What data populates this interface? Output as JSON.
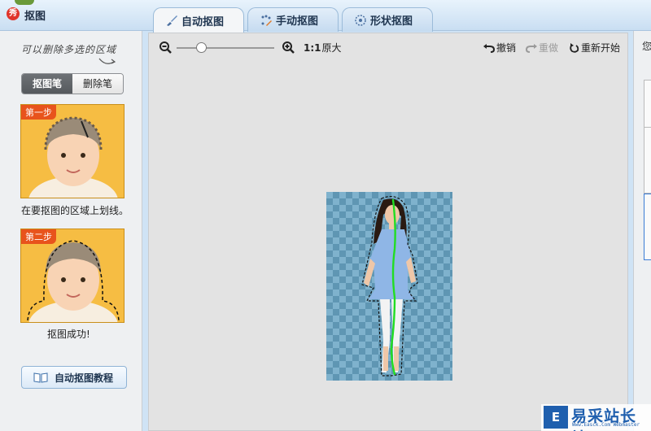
{
  "window": {
    "title": "抠图",
    "logo_char": "秀"
  },
  "tabs": [
    {
      "label": "自动抠图",
      "icon": "brush-icon",
      "active": true
    },
    {
      "label": "手动抠图",
      "icon": "dotted-brush-icon",
      "active": false
    },
    {
      "label": "形状抠图",
      "icon": "shape-icon",
      "active": false
    }
  ],
  "left_panel": {
    "hint": "可以删除多选的区域",
    "segmented": {
      "draw_label": "抠图笔",
      "erase_label": "删除笔",
      "selected": "抠图笔"
    },
    "steps": [
      {
        "badge": "第一步",
        "caption": "在要抠图的区域上划线。"
      },
      {
        "badge": "第二步",
        "caption": "抠图成功!"
      }
    ],
    "tutorial_button": "自动抠图教程"
  },
  "toolbar": {
    "zoom_level": 0.25,
    "actual_size_prefix": "1:1",
    "actual_size_label": "原大",
    "undo_label": "撤销",
    "redo_label": "重做",
    "restart_label": "重新开始"
  },
  "right_panel": {
    "label": "您"
  },
  "watermark": {
    "logo": "E",
    "text": "易采站长站",
    "sub": "Www.Easck.Com Webmaster"
  },
  "colors": {
    "accent_tab": "#c5dbf0",
    "checker_dark": "#5f96b3",
    "checker_light": "#7fb2cd",
    "stroke_green": "#22dd22",
    "badge_orange": "#e8531c"
  }
}
